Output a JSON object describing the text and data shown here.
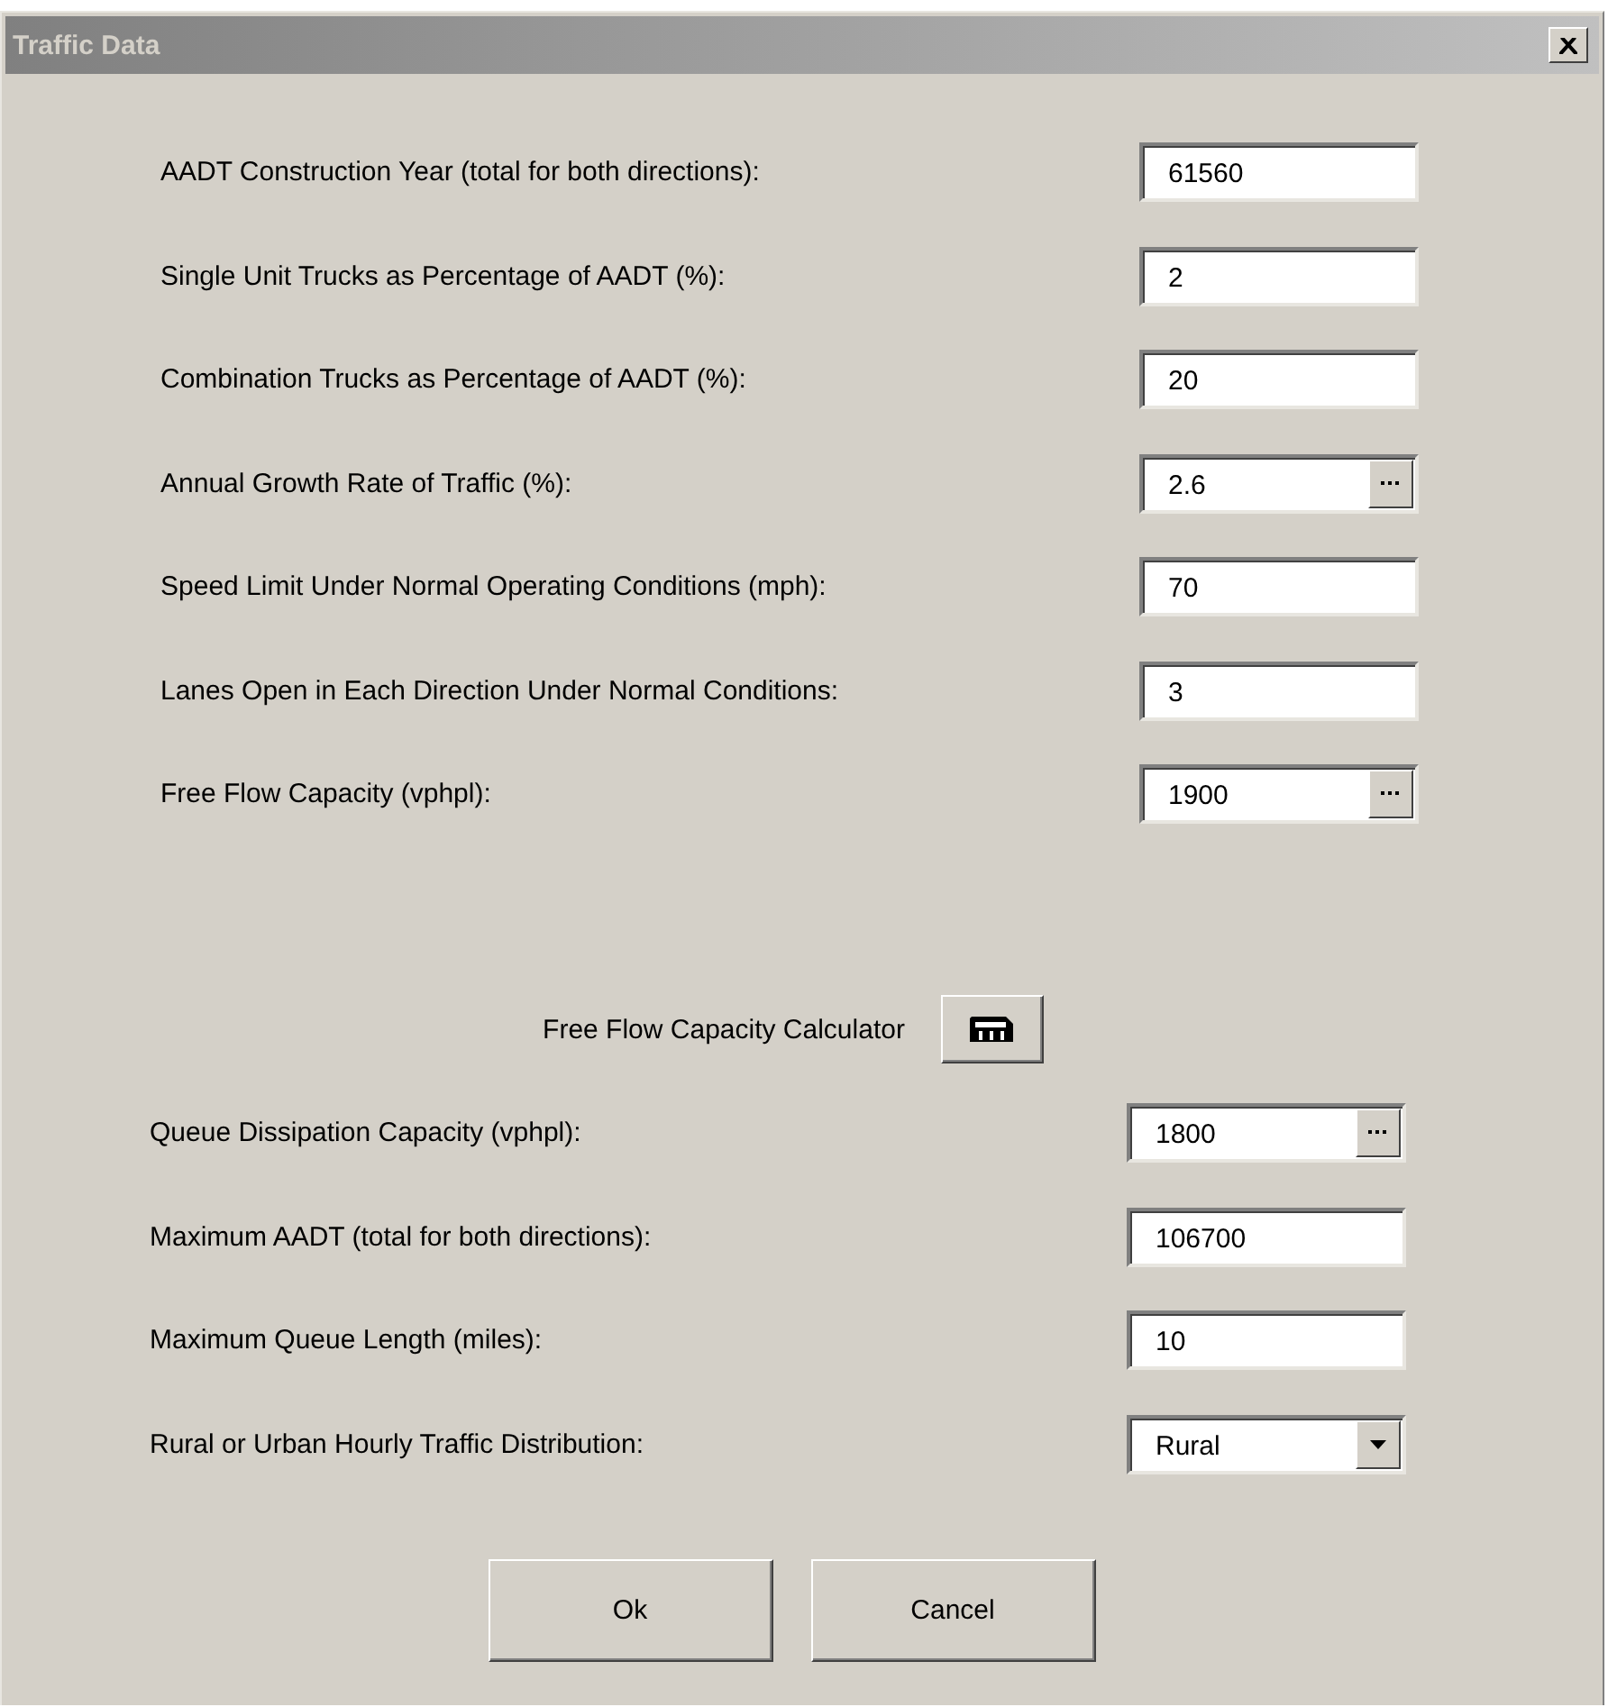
{
  "window": {
    "title": "Traffic Data"
  },
  "fields": [
    {
      "label": "AADT Construction Year (total for both directions):",
      "value": "61560",
      "kind": "text"
    },
    {
      "label": "Single Unit Trucks as Percentage of AADT (%):",
      "value": "2",
      "kind": "text"
    },
    {
      "label": "Combination Trucks as Percentage of AADT (%):",
      "value": "20",
      "kind": "text"
    },
    {
      "label": "Annual Growth Rate of Traffic (%):",
      "value": "2.6",
      "kind": "lookup"
    },
    {
      "label": "Speed Limit Under Normal Operating Conditions (mph):",
      "value": "70",
      "kind": "text"
    },
    {
      "label": "Lanes Open in Each Direction Under Normal Conditions:",
      "value": "3",
      "kind": "text"
    },
    {
      "label": "Free Flow Capacity (vphpl):",
      "value": "1900",
      "kind": "lookup"
    }
  ],
  "calculator": {
    "label": "Free Flow Capacity Calculator"
  },
  "fields_2": [
    {
      "label": "Queue Dissipation Capacity (vphpl):",
      "value": "1800",
      "kind": "lookup"
    },
    {
      "label": "Maximum AADT (total for both directions):",
      "value": "106700",
      "kind": "text"
    },
    {
      "label": "Maximum Queue Length (miles):",
      "value": "10",
      "kind": "text"
    },
    {
      "label": "Rural or Urban Hourly Traffic Distribution:",
      "value": "Rural",
      "kind": "dropdown"
    }
  ],
  "buttons": [
    "Ok",
    "Cancel"
  ]
}
